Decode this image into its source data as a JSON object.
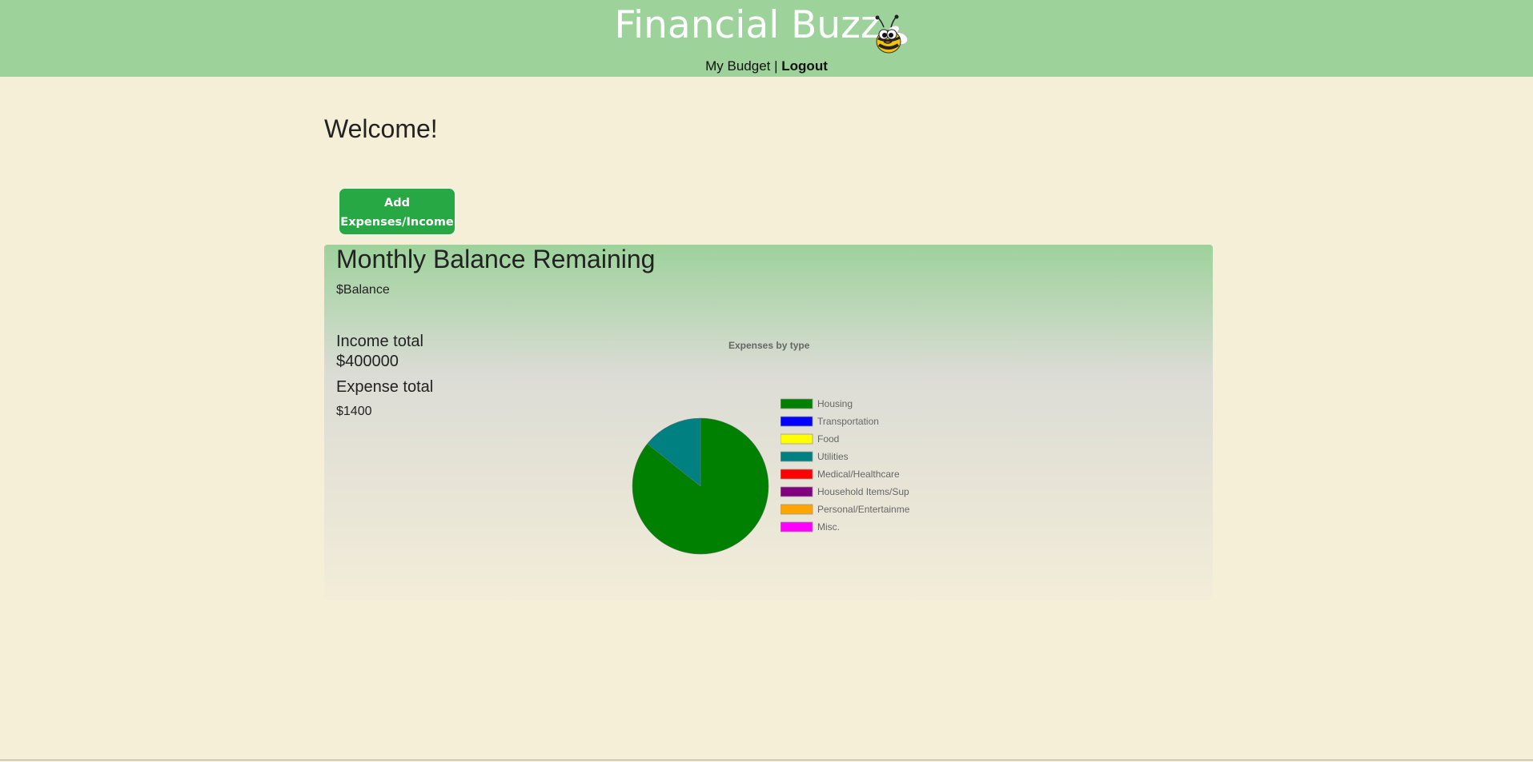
{
  "header": {
    "brand": "Financial Buzz",
    "nav": {
      "my_budget": "My Budget",
      "separator": "|",
      "logout": "Logout"
    }
  },
  "main": {
    "welcome": "Welcome!",
    "add_button": "Add Expenses/Income",
    "panel": {
      "title": "Monthly Balance Remaining",
      "balance": "$Balance",
      "income_label": "Income total",
      "income_value": "$400000",
      "expense_label": "Expense total",
      "expense_value": "$1400"
    }
  },
  "colors": {
    "header_bg": "#9dd29b",
    "page_bg": "#f6efd8",
    "button_bg": "#28a745"
  },
  "chart_data": {
    "type": "pie",
    "title": "Expenses by type",
    "legend_position": "right",
    "categories": [
      "Housing",
      "Transportation",
      "Food",
      "Utilities",
      "Medical/Healthcare",
      "Household Items/Sup",
      "Personal/Entertainme",
      "Misc."
    ],
    "values": [
      1200,
      0,
      0,
      200,
      0,
      0,
      0,
      0
    ],
    "colors": [
      "#008000",
      "#0000ff",
      "#ffff00",
      "#008080",
      "#ff0000",
      "#800080",
      "#ffa500",
      "#ff00ff"
    ]
  }
}
